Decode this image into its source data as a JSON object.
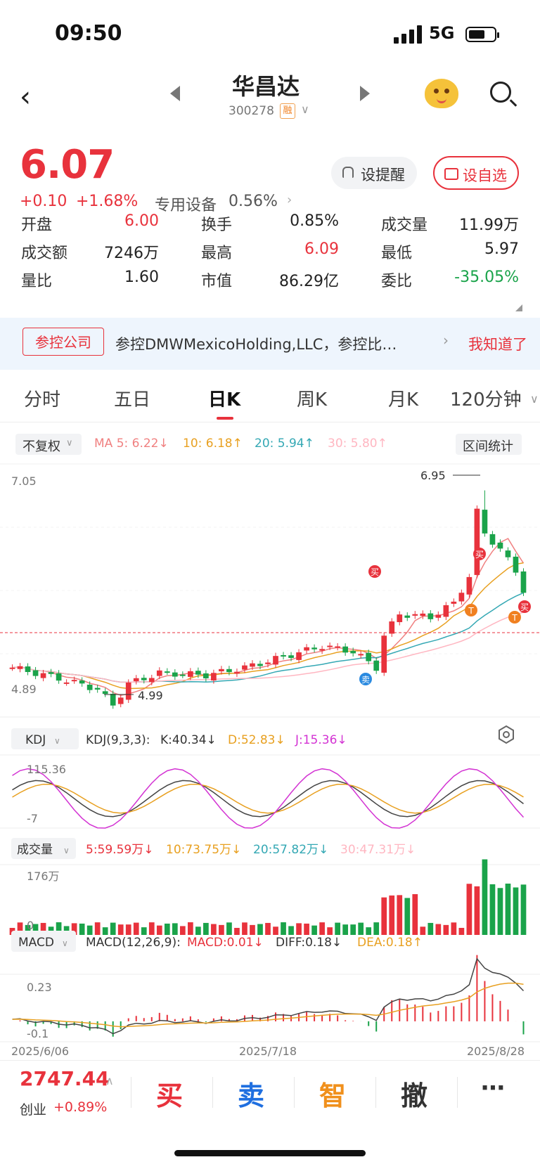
{
  "status": {
    "time": "09:50",
    "network": "5G"
  },
  "header": {
    "name": "华昌达",
    "code": "300278",
    "badge": "融"
  },
  "price": {
    "last": "6.07",
    "change": "+0.10",
    "pct": "+1.68%",
    "sector": "专用设备",
    "sector_pct": "0.56%",
    "remind_label": "设提醒",
    "fav_label": "设自选"
  },
  "quote": [
    {
      "label": "开盘",
      "value": "6.00",
      "color": "red"
    },
    {
      "label": "换手",
      "value": "0.85%",
      "color": "dark"
    },
    {
      "label": "成交量",
      "value": "11.99万",
      "color": "dark"
    },
    {
      "label": "成交额",
      "value": "7246万",
      "color": "dark"
    },
    {
      "label": "最高",
      "value": "6.09",
      "color": "red"
    },
    {
      "label": "最低",
      "value": "5.97",
      "color": "dark"
    },
    {
      "label": "量比",
      "value": "1.60",
      "color": "dark"
    },
    {
      "label": "市值",
      "value": "86.29亿",
      "color": "dark"
    },
    {
      "label": "委比",
      "value": "-35.05%",
      "color": "green"
    }
  ],
  "notice": {
    "tag": "参控公司",
    "text": "参控DMWMexicoHolding,LLC，参控比…",
    "ack": "我知道了"
  },
  "tabs": [
    "分时",
    "五日",
    "日K",
    "周K",
    "月K",
    "120分钟"
  ],
  "ma_row": {
    "fq": "不复权",
    "ma5": "MA 5: 6.22↓",
    "ma10": "10: 6.18↑",
    "ma20": "20: 5.94↑",
    "ma30": "30: 5.80↑",
    "range": "区间统计"
  },
  "kline": {
    "y_top": "7.05",
    "y_bottom": "4.89",
    "high_label": "6.95",
    "low_label": "4.99",
    "buy": "买",
    "sell": "卖",
    "t": "T"
  },
  "kdj": {
    "btn": "KDJ",
    "title": "KDJ(9,3,3):",
    "k": "K:40.34↓",
    "d": "D:52.83↓",
    "j": "J:15.36↓",
    "y_top": "115.36",
    "y_bottom": "-7"
  },
  "volume": {
    "btn": "成交量",
    "v5": "5:59.59万↓",
    "v10": "10:73.75万↓",
    "v20": "20:57.82万↓",
    "v30": "30:47.31万↓",
    "y_top": "176万",
    "y_bottom": "0"
  },
  "macd": {
    "btn": "MACD",
    "title": "MACD(12,26,9):",
    "macd": "MACD:0.01↓",
    "diff": "DIFF:0.18↓",
    "dea": "DEA:0.18↑",
    "y_top": "0.23",
    "y_bottom": "-0.1"
  },
  "dates": [
    "2025/6/06",
    "2025/7/18",
    "2025/8/28"
  ],
  "bottom": {
    "index_value": "2747.44",
    "index_name": "创业",
    "index_pct": "+0.89%",
    "buy": "买",
    "sell": "卖",
    "smart": "智",
    "cancel": "撤",
    "more": "⋯"
  },
  "colors": {
    "up": "#e8323c",
    "down": "#1aa34a",
    "ma5": "#f08080",
    "ma10": "#e8a020",
    "ma20": "#34a8b4",
    "ma30": "#ffb6c1"
  }
}
